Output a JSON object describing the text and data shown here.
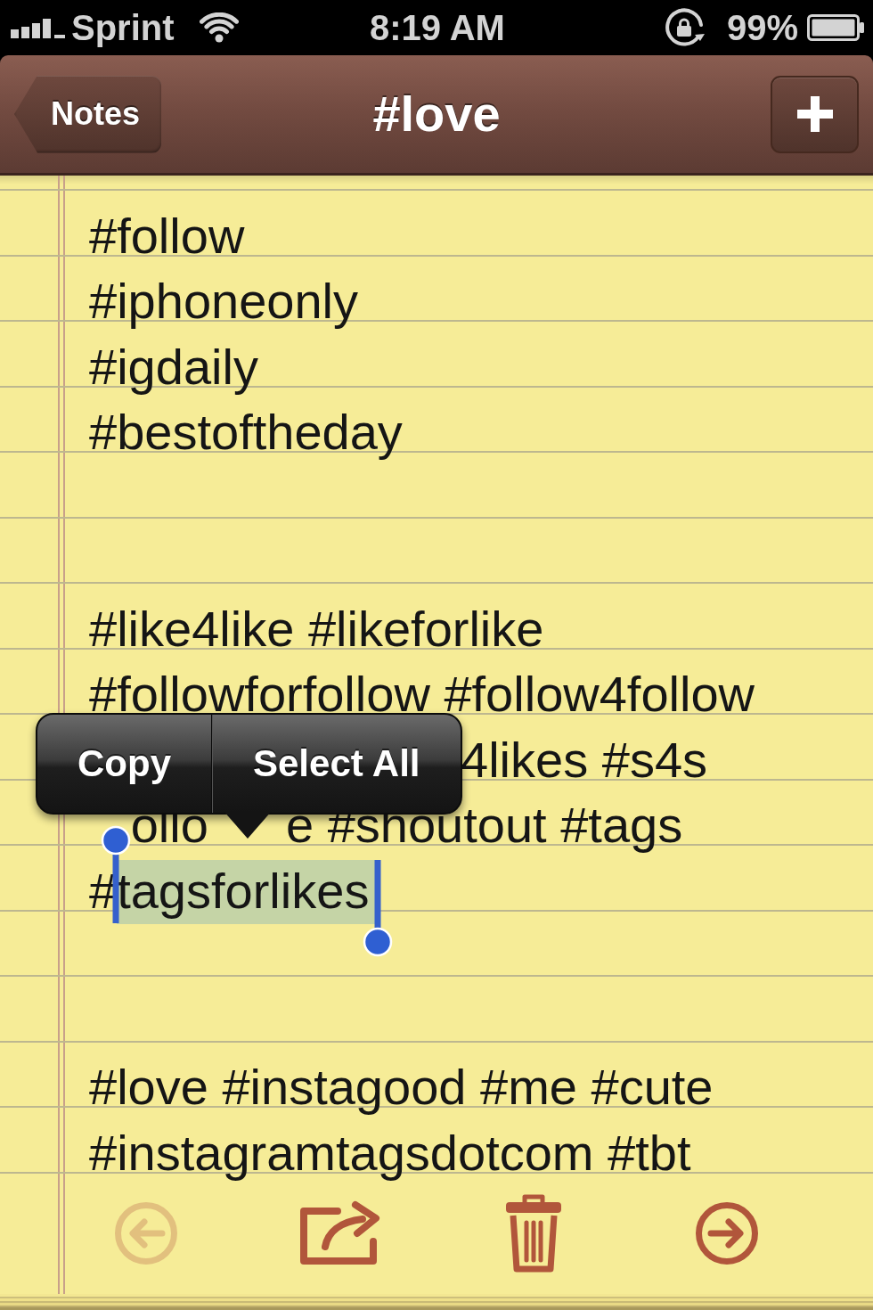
{
  "status_bar": {
    "carrier": "Sprint",
    "time": "8:19 AM",
    "battery": "99%"
  },
  "nav_bar": {
    "back_button": "Notes",
    "title": "#love"
  },
  "note": {
    "lines": [
      {
        "kind": "text",
        "text": "#follow"
      },
      {
        "kind": "text",
        "text": "#iphoneonly"
      },
      {
        "kind": "text",
        "text": "#igdaily"
      },
      {
        "kind": "text",
        "text": "#bestoftheday"
      },
      {
        "kind": "blank"
      },
      {
        "kind": "blank"
      },
      {
        "kind": "text",
        "text": "#like4like #likeforlike"
      },
      {
        "kind": "text",
        "text": "#followforfollow #follow4follow"
      },
      {
        "kind": "covered",
        "text": "4likes #s4s"
      },
      {
        "kind": "fragments",
        "segments": [
          {
            "text": "ollo"
          },
          {
            "text": "e #shoutout #tags"
          }
        ]
      },
      {
        "kind": "selection",
        "segments": [
          {
            "text": "#",
            "selected": false
          },
          {
            "text": "tagsforlikes",
            "selected": true
          }
        ]
      },
      {
        "kind": "blank"
      },
      {
        "kind": "blank"
      },
      {
        "kind": "text",
        "text": "#love #instagood #me #cute"
      },
      {
        "kind": "text",
        "text": "#instagramtagsdotcom #tbt"
      }
    ]
  },
  "edit_menu": {
    "items": [
      {
        "label": "Copy"
      },
      {
        "label": "Select All"
      }
    ]
  },
  "toolbar": {
    "items": [
      {
        "kind": "previous",
        "disabled": true
      },
      {
        "kind": "share",
        "disabled": false
      },
      {
        "kind": "trash",
        "disabled": false
      },
      {
        "kind": "next",
        "disabled": false
      }
    ]
  }
}
